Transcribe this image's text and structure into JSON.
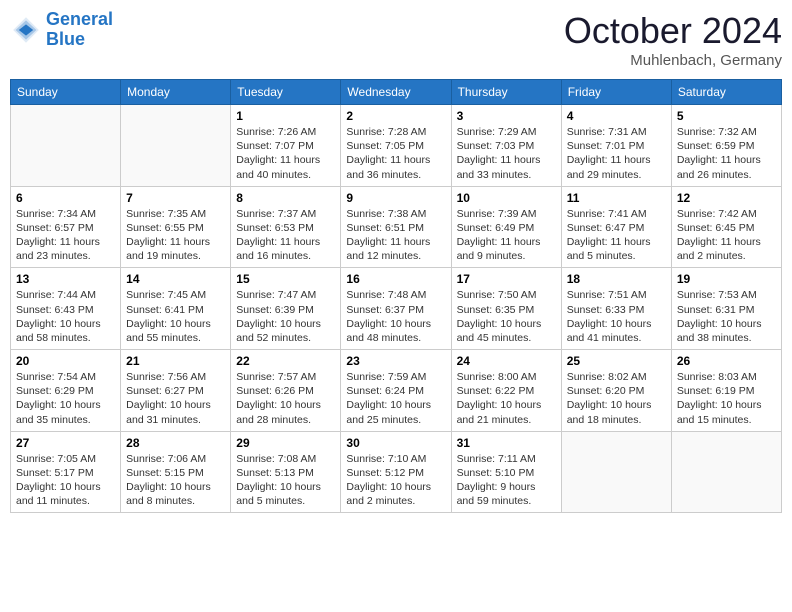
{
  "header": {
    "logo_line1": "General",
    "logo_line2": "Blue",
    "month": "October 2024",
    "location": "Muhlenbach, Germany"
  },
  "days_of_week": [
    "Sunday",
    "Monday",
    "Tuesday",
    "Wednesday",
    "Thursday",
    "Friday",
    "Saturday"
  ],
  "weeks": [
    [
      {
        "day": "",
        "info": ""
      },
      {
        "day": "",
        "info": ""
      },
      {
        "day": "1",
        "info": "Sunrise: 7:26 AM\nSunset: 7:07 PM\nDaylight: 11 hours and 40 minutes."
      },
      {
        "day": "2",
        "info": "Sunrise: 7:28 AM\nSunset: 7:05 PM\nDaylight: 11 hours and 36 minutes."
      },
      {
        "day": "3",
        "info": "Sunrise: 7:29 AM\nSunset: 7:03 PM\nDaylight: 11 hours and 33 minutes."
      },
      {
        "day": "4",
        "info": "Sunrise: 7:31 AM\nSunset: 7:01 PM\nDaylight: 11 hours and 29 minutes."
      },
      {
        "day": "5",
        "info": "Sunrise: 7:32 AM\nSunset: 6:59 PM\nDaylight: 11 hours and 26 minutes."
      }
    ],
    [
      {
        "day": "6",
        "info": "Sunrise: 7:34 AM\nSunset: 6:57 PM\nDaylight: 11 hours and 23 minutes."
      },
      {
        "day": "7",
        "info": "Sunrise: 7:35 AM\nSunset: 6:55 PM\nDaylight: 11 hours and 19 minutes."
      },
      {
        "day": "8",
        "info": "Sunrise: 7:37 AM\nSunset: 6:53 PM\nDaylight: 11 hours and 16 minutes."
      },
      {
        "day": "9",
        "info": "Sunrise: 7:38 AM\nSunset: 6:51 PM\nDaylight: 11 hours and 12 minutes."
      },
      {
        "day": "10",
        "info": "Sunrise: 7:39 AM\nSunset: 6:49 PM\nDaylight: 11 hours and 9 minutes."
      },
      {
        "day": "11",
        "info": "Sunrise: 7:41 AM\nSunset: 6:47 PM\nDaylight: 11 hours and 5 minutes."
      },
      {
        "day": "12",
        "info": "Sunrise: 7:42 AM\nSunset: 6:45 PM\nDaylight: 11 hours and 2 minutes."
      }
    ],
    [
      {
        "day": "13",
        "info": "Sunrise: 7:44 AM\nSunset: 6:43 PM\nDaylight: 10 hours and 58 minutes."
      },
      {
        "day": "14",
        "info": "Sunrise: 7:45 AM\nSunset: 6:41 PM\nDaylight: 10 hours and 55 minutes."
      },
      {
        "day": "15",
        "info": "Sunrise: 7:47 AM\nSunset: 6:39 PM\nDaylight: 10 hours and 52 minutes."
      },
      {
        "day": "16",
        "info": "Sunrise: 7:48 AM\nSunset: 6:37 PM\nDaylight: 10 hours and 48 minutes."
      },
      {
        "day": "17",
        "info": "Sunrise: 7:50 AM\nSunset: 6:35 PM\nDaylight: 10 hours and 45 minutes."
      },
      {
        "day": "18",
        "info": "Sunrise: 7:51 AM\nSunset: 6:33 PM\nDaylight: 10 hours and 41 minutes."
      },
      {
        "day": "19",
        "info": "Sunrise: 7:53 AM\nSunset: 6:31 PM\nDaylight: 10 hours and 38 minutes."
      }
    ],
    [
      {
        "day": "20",
        "info": "Sunrise: 7:54 AM\nSunset: 6:29 PM\nDaylight: 10 hours and 35 minutes."
      },
      {
        "day": "21",
        "info": "Sunrise: 7:56 AM\nSunset: 6:27 PM\nDaylight: 10 hours and 31 minutes."
      },
      {
        "day": "22",
        "info": "Sunrise: 7:57 AM\nSunset: 6:26 PM\nDaylight: 10 hours and 28 minutes."
      },
      {
        "day": "23",
        "info": "Sunrise: 7:59 AM\nSunset: 6:24 PM\nDaylight: 10 hours and 25 minutes."
      },
      {
        "day": "24",
        "info": "Sunrise: 8:00 AM\nSunset: 6:22 PM\nDaylight: 10 hours and 21 minutes."
      },
      {
        "day": "25",
        "info": "Sunrise: 8:02 AM\nSunset: 6:20 PM\nDaylight: 10 hours and 18 minutes."
      },
      {
        "day": "26",
        "info": "Sunrise: 8:03 AM\nSunset: 6:19 PM\nDaylight: 10 hours and 15 minutes."
      }
    ],
    [
      {
        "day": "27",
        "info": "Sunrise: 7:05 AM\nSunset: 5:17 PM\nDaylight: 10 hours and 11 minutes."
      },
      {
        "day": "28",
        "info": "Sunrise: 7:06 AM\nSunset: 5:15 PM\nDaylight: 10 hours and 8 minutes."
      },
      {
        "day": "29",
        "info": "Sunrise: 7:08 AM\nSunset: 5:13 PM\nDaylight: 10 hours and 5 minutes."
      },
      {
        "day": "30",
        "info": "Sunrise: 7:10 AM\nSunset: 5:12 PM\nDaylight: 10 hours and 2 minutes."
      },
      {
        "day": "31",
        "info": "Sunrise: 7:11 AM\nSunset: 5:10 PM\nDaylight: 9 hours and 59 minutes."
      },
      {
        "day": "",
        "info": ""
      },
      {
        "day": "",
        "info": ""
      }
    ]
  ]
}
